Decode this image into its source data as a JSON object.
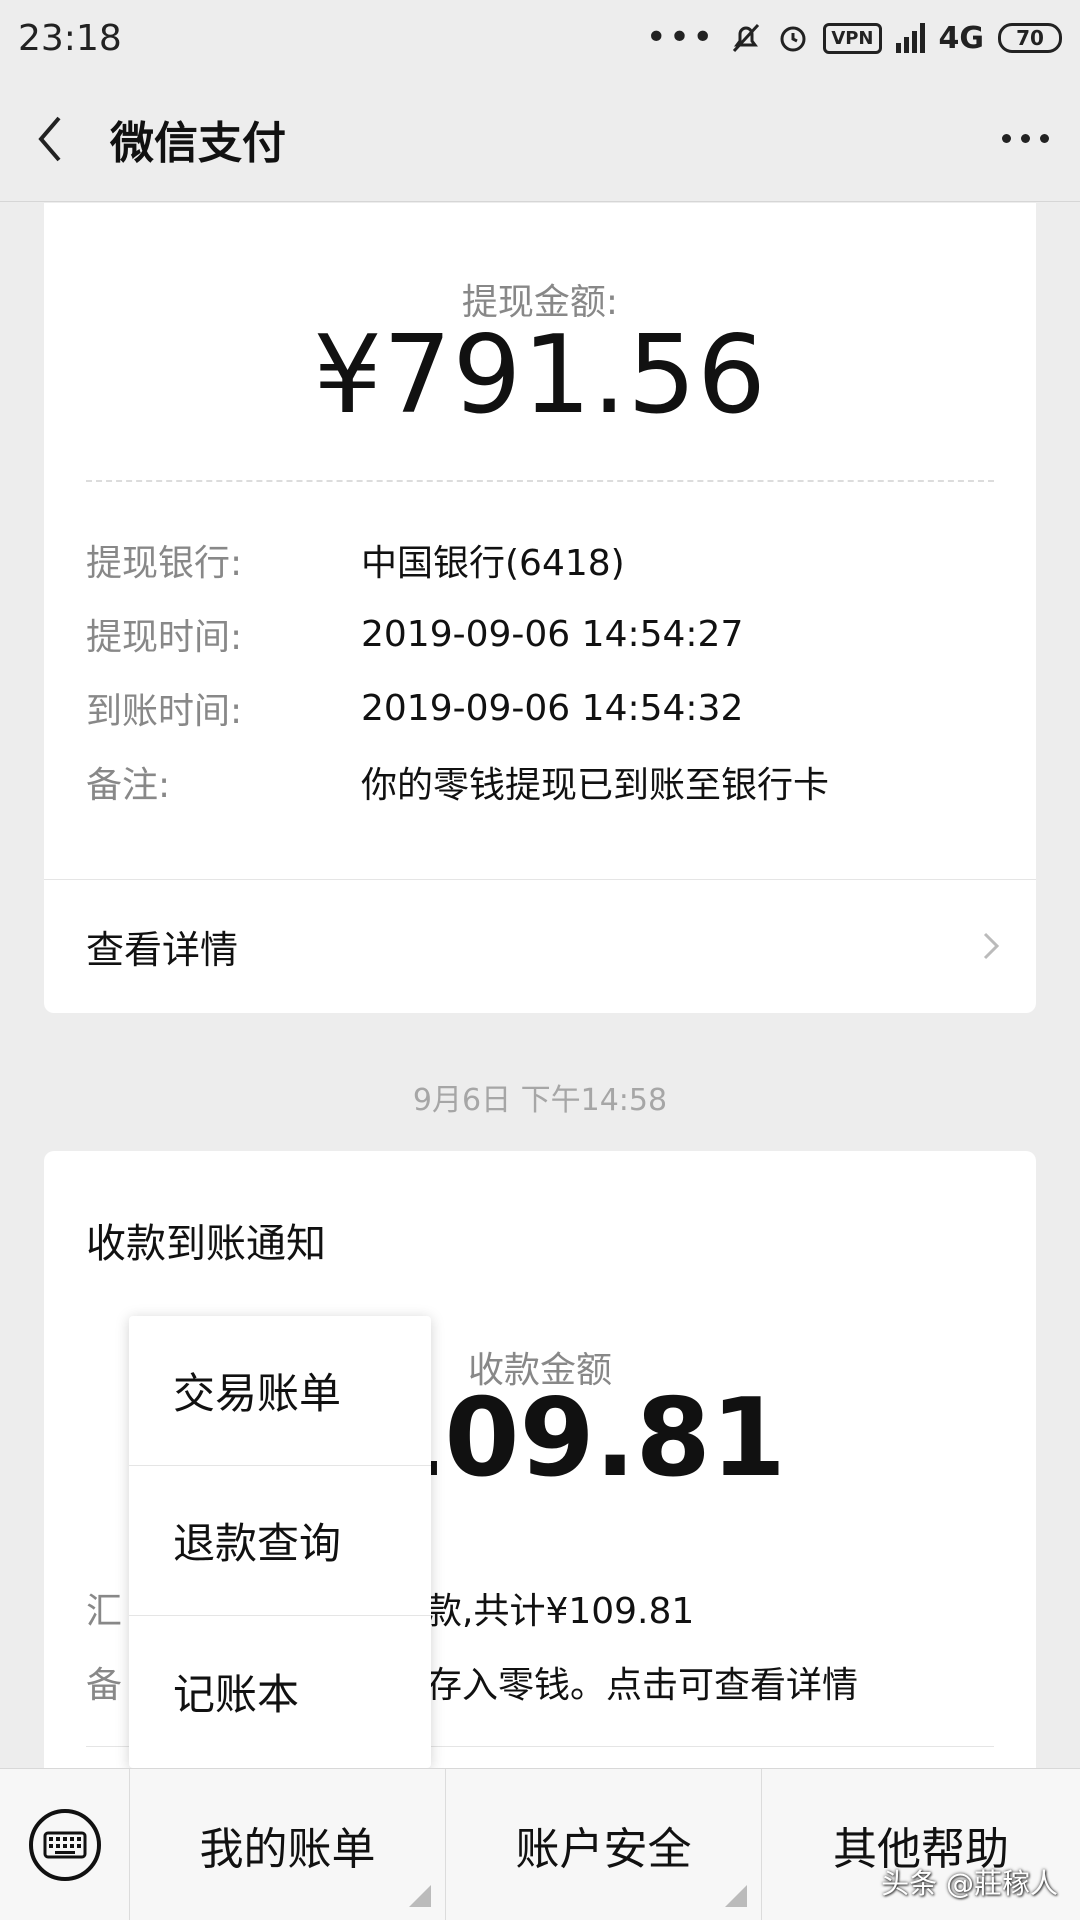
{
  "status_bar": {
    "time": "23:18",
    "network": "4G",
    "vpn": "VPN",
    "battery": "70"
  },
  "nav": {
    "title": "微信支付"
  },
  "withdraw_card": {
    "amount_label": "提现金额:",
    "amount": "¥791.56",
    "rows": [
      {
        "key": "提现银行:",
        "value": "中国银行(6418)"
      },
      {
        "key": "提现时间:",
        "value": "2019-09-06 14:54:27"
      },
      {
        "key": "到账时间:",
        "value": "2019-09-06 14:54:32"
      },
      {
        "key": "备注:",
        "value": "你的零钱提现已到账至银行卡"
      }
    ],
    "detail_link": "查看详情"
  },
  "timestamp": "9月6日 下午14:58",
  "receipt_card": {
    "title": "收款到账通知",
    "amount_label": "收款金额",
    "amount": "¥109.81",
    "rows": [
      {
        "key": "汇",
        "value": "款,共计¥109.81"
      },
      {
        "key": "备",
        "value": "存入零钱。点击可查看详情"
      }
    ]
  },
  "popup_menu": {
    "items": [
      "交易账单",
      "退款查询",
      "记账本"
    ]
  },
  "bottom_menu": {
    "tabs": [
      "我的账单",
      "账户安全",
      "其他帮助"
    ]
  },
  "watermark": "头条 @莊稼人"
}
